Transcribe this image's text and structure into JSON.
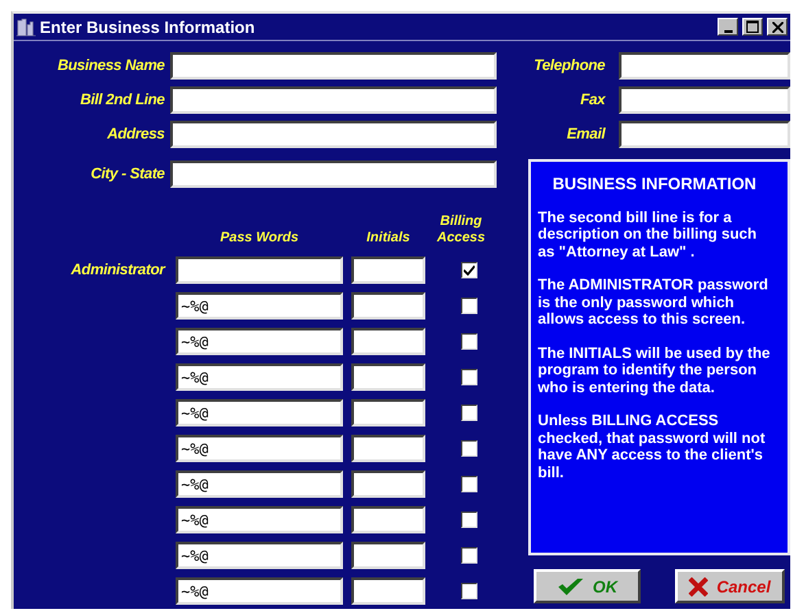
{
  "window": {
    "title": "Enter Business Information"
  },
  "left_fields": [
    {
      "label": "Business Name"
    },
    {
      "label": "Bill 2nd Line"
    },
    {
      "label": "Address"
    },
    {
      "label": "City - State"
    }
  ],
  "right_fields": [
    {
      "label": "Telephone"
    },
    {
      "label": "Fax"
    },
    {
      "label": "Email"
    }
  ],
  "passwords": {
    "columns": [
      "Pass Words",
      "Initials",
      "Billing Access"
    ],
    "rows": [
      {
        "label": "Administrator",
        "billing_access": true
      },
      {
        "value": "~%@",
        "billing_access": false
      },
      {
        "value": "~%@",
        "billing_access": false
      },
      {
        "value": "~%@",
        "billing_access": false
      },
      {
        "value": "~%@",
        "billing_access": false
      },
      {
        "value": "~%@",
        "billing_access": false
      },
      {
        "value": "~%@",
        "billing_access": false
      },
      {
        "value": "~%@",
        "billing_access": false
      },
      {
        "value": "~%@",
        "billing_access": false
      },
      {
        "value": "~%@",
        "billing_access": false
      }
    ]
  },
  "info": {
    "title": "BUSINESS INFORMATION",
    "paragraphs": [
      "The second bill line is for a description on the billing such as \"Attorney at Law\" .",
      "The ADMINISTRATOR password is the only password which allows access to this screen.",
      "The INITIALS will be used by the program to identify the person who is entering the data.",
      "Unless BILLING ACCESS checked,  that password will not have ANY access to the client's bill."
    ]
  },
  "buttons": [
    {
      "kind": "ok",
      "label": "OK"
    },
    {
      "kind": "cancel",
      "label": "Cancel"
    }
  ]
}
